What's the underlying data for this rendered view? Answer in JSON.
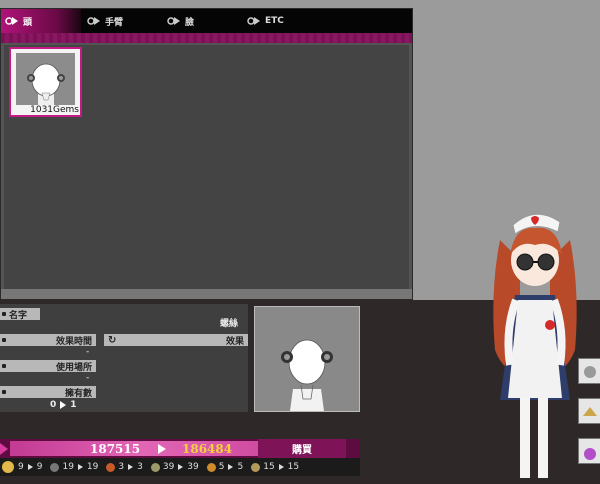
{
  "tabs": [
    {
      "label": "頭",
      "active": true
    },
    {
      "label": "手臂",
      "active": false
    },
    {
      "label": "臉",
      "active": false
    },
    {
      "label": "ETC",
      "active": false
    }
  ],
  "item": {
    "price": "1031Gems"
  },
  "details": {
    "name_label": "名字",
    "name_value": "螺絲",
    "effect_time_label": "效果時間",
    "effect_time_value": "-",
    "effect_label": "效果",
    "use_place_label": "使用場所",
    "use_place_value": "-",
    "owned_label": "擁有數",
    "owned_from": "0",
    "owned_to": "1"
  },
  "currency": {
    "value1": "187515",
    "value2": "186484",
    "buy_label": "購買"
  },
  "stats": [
    {
      "from": "9",
      "to": "9",
      "color": "#d2a22a"
    },
    {
      "from": "19",
      "to": "19",
      "color": "#777777"
    },
    {
      "from": "3",
      "to": "3",
      "color": "#c85a2a"
    },
    {
      "from": "39",
      "to": "39",
      "color": "#9a9a6a"
    },
    {
      "from": "5",
      "to": "5",
      "color": "#d08a2a"
    },
    {
      "from": "15",
      "to": "15",
      "color": "#b49a5a"
    }
  ],
  "colors": {
    "accent": "#b1137a",
    "price_white": "#ffffff",
    "price_gold": "#f4d23a"
  }
}
